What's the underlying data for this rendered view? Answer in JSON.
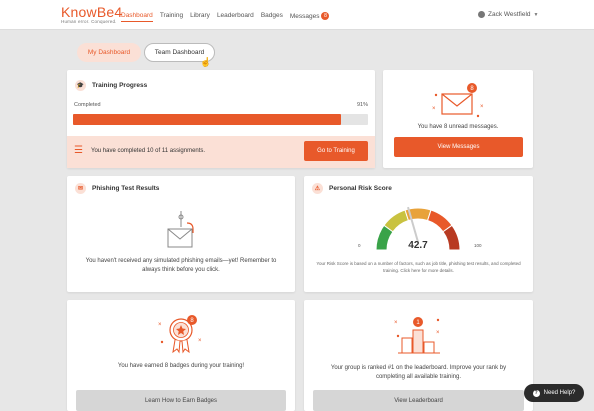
{
  "brand": {
    "name": "KnowBe4",
    "tagline": "Human error. Conquered."
  },
  "nav": {
    "items": [
      "Dashboard",
      "Training",
      "Library",
      "Leaderboard",
      "Badges",
      "Messages"
    ],
    "messages_badge": "8"
  },
  "user": {
    "name": "Zack Westfield"
  },
  "dashboard_tabs": {
    "my": "My Dashboard",
    "team": "Team Dashboard"
  },
  "training": {
    "title": "Training Progress",
    "completed_label": "Completed",
    "percent_text": "91%",
    "progress": 0.91,
    "summary": "You have completed 10 of 11 assignments.",
    "button": "Go to Training"
  },
  "messages_card": {
    "count": "8",
    "text": "You have 8 unread messages.",
    "button": "View Messages"
  },
  "phishing": {
    "title": "Phishing Test Results",
    "text": "You haven't received any simulated phishing emails—yet! Remember to always think before you click."
  },
  "risk": {
    "title": "Personal Risk Score",
    "score": "42.7",
    "min": "0",
    "max": "100",
    "score_value": 42.7,
    "description": "Your Risk Score is based on a number of factors, such as job title, phishing test results, and completed training. Click here for more details.",
    "colors": [
      "#3aa349",
      "#c9c240",
      "#e8a23a",
      "#e8592a",
      "#b83a22"
    ]
  },
  "badges": {
    "count": "8",
    "text": "You have earned 8 badges during your training!",
    "button": "Learn How to Earn Badges"
  },
  "leaderboard": {
    "rank": "1",
    "text": "Your group is ranked #1 on the leaderboard. Improve your rank by completing all available training.",
    "button": "View Leaderboard"
  },
  "help": {
    "label": "Need Help?"
  },
  "accent": "#e8592a"
}
